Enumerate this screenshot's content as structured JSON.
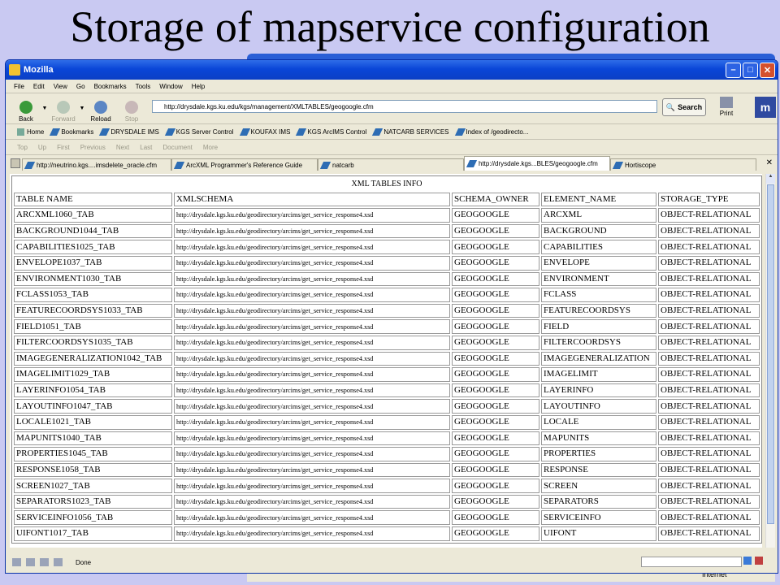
{
  "slide": {
    "title": "Storage of mapservice configuration"
  },
  "back_window": {
    "status_zone": "Internet"
  },
  "window": {
    "title": "Mozilla"
  },
  "menubar": [
    "File",
    "Edit",
    "View",
    "Go",
    "Bookmarks",
    "Tools",
    "Window",
    "Help"
  ],
  "nav": {
    "back": "Back",
    "forward": "Forward",
    "reload": "Reload",
    "stop": "Stop",
    "url": "http://drysdale.kgs.ku.edu/kgs/management/XMLTABLES/geogoogle.cfm",
    "search": "Search",
    "print": "Print",
    "brand": "m"
  },
  "bookmarks": [
    "Home",
    "Bookmarks",
    "DRYSDALE IMS",
    "KGS Server Control",
    "KOUFAX IMS",
    "KGS ArcIMS Control",
    "NATCARB SERVICES",
    "Index of /geodirecto..."
  ],
  "sitenav": [
    "Top",
    "Up",
    "First",
    "Previous",
    "Next",
    "Last",
    "Document",
    "More"
  ],
  "tabs": [
    "http://neutrino.kgs....imsdelete_oracle.cfm",
    "ArcXML Programmer's Reference Guide",
    "natcarb",
    "http://drysdale.kgs...BLES/geogoogle.cfm",
    "Hortiscope"
  ],
  "table": {
    "caption": "XML TABLES INFO",
    "headers": [
      "TABLE NAME",
      "XMLSCHEMA",
      "SCHEMA_OWNER",
      "ELEMENT_NAME",
      "STORAGE_TYPE"
    ],
    "rows": [
      [
        "ARCXML1060_TAB",
        "http://drysdale.kgs.ku.edu/geodirectory/arcims/get_service_response4.xsd",
        "GEOGOOGLE",
        "ARCXML",
        "OBJECT-RELATIONAL"
      ],
      [
        "BACKGROUND1044_TAB",
        "http://drysdale.kgs.ku.edu/geodirectory/arcims/get_service_response4.xsd",
        "GEOGOOGLE",
        "BACKGROUND",
        "OBJECT-RELATIONAL"
      ],
      [
        "CAPABILITIES1025_TAB",
        "http://drysdale.kgs.ku.edu/geodirectory/arcims/get_service_response4.xsd",
        "GEOGOOGLE",
        "CAPABILITIES",
        "OBJECT-RELATIONAL"
      ],
      [
        "ENVELOPE1037_TAB",
        "http://drysdale.kgs.ku.edu/geodirectory/arcims/get_service_response4.xsd",
        "GEOGOOGLE",
        "ENVELOPE",
        "OBJECT-RELATIONAL"
      ],
      [
        "ENVIRONMENT1030_TAB",
        "http://drysdale.kgs.ku.edu/geodirectory/arcims/get_service_response4.xsd",
        "GEOGOOGLE",
        "ENVIRONMENT",
        "OBJECT-RELATIONAL"
      ],
      [
        "FCLASS1053_TAB",
        "http://drysdale.kgs.ku.edu/geodirectory/arcims/get_service_response4.xsd",
        "GEOGOOGLE",
        "FCLASS",
        "OBJECT-RELATIONAL"
      ],
      [
        "FEATURECOORDSYS1033_TAB",
        "http://drysdale.kgs.ku.edu/geodirectory/arcims/get_service_response4.xsd",
        "GEOGOOGLE",
        "FEATURECOORDSYS",
        "OBJECT-RELATIONAL"
      ],
      [
        "FIELD1051_TAB",
        "http://drysdale.kgs.ku.edu/geodirectory/arcims/get_service_response4.xsd",
        "GEOGOOGLE",
        "FIELD",
        "OBJECT-RELATIONAL"
      ],
      [
        "FILTERCOORDSYS1035_TAB",
        "http://drysdale.kgs.ku.edu/geodirectory/arcims/get_service_response4.xsd",
        "GEOGOOGLE",
        "FILTERCOORDSYS",
        "OBJECT-RELATIONAL"
      ],
      [
        "IMAGEGENERALIZATION1042_TAB",
        "http://drysdale.kgs.ku.edu/geodirectory/arcims/get_service_response4.xsd",
        "GEOGOOGLE",
        "IMAGEGENERALIZATION",
        "OBJECT-RELATIONAL"
      ],
      [
        "IMAGELIMIT1029_TAB",
        "http://drysdale.kgs.ku.edu/geodirectory/arcims/get_service_response4.xsd",
        "GEOGOOGLE",
        "IMAGELIMIT",
        "OBJECT-RELATIONAL"
      ],
      [
        "LAYERINFO1054_TAB",
        "http://drysdale.kgs.ku.edu/geodirectory/arcims/get_service_response4.xsd",
        "GEOGOOGLE",
        "LAYERINFO",
        "OBJECT-RELATIONAL"
      ],
      [
        "LAYOUTINFO1047_TAB",
        "http://drysdale.kgs.ku.edu/geodirectory/arcims/get_service_response4.xsd",
        "GEOGOOGLE",
        "LAYOUTINFO",
        "OBJECT-RELATIONAL"
      ],
      [
        "LOCALE1021_TAB",
        "http://drysdale.kgs.ku.edu/geodirectory/arcims/get_service_response4.xsd",
        "GEOGOOGLE",
        "LOCALE",
        "OBJECT-RELATIONAL"
      ],
      [
        "MAPUNITS1040_TAB",
        "http://drysdale.kgs.ku.edu/geodirectory/arcims/get_service_response4.xsd",
        "GEOGOOGLE",
        "MAPUNITS",
        "OBJECT-RELATIONAL"
      ],
      [
        "PROPERTIES1045_TAB",
        "http://drysdale.kgs.ku.edu/geodirectory/arcims/get_service_response4.xsd",
        "GEOGOOGLE",
        "PROPERTIES",
        "OBJECT-RELATIONAL"
      ],
      [
        "RESPONSE1058_TAB",
        "http://drysdale.kgs.ku.edu/geodirectory/arcims/get_service_response4.xsd",
        "GEOGOOGLE",
        "RESPONSE",
        "OBJECT-RELATIONAL"
      ],
      [
        "SCREEN1027_TAB",
        "http://drysdale.kgs.ku.edu/geodirectory/arcims/get_service_response4.xsd",
        "GEOGOOGLE",
        "SCREEN",
        "OBJECT-RELATIONAL"
      ],
      [
        "SEPARATORS1023_TAB",
        "http://drysdale.kgs.ku.edu/geodirectory/arcims/get_service_response4.xsd",
        "GEOGOOGLE",
        "SEPARATORS",
        "OBJECT-RELATIONAL"
      ],
      [
        "SERVICEINFO1056_TAB",
        "http://drysdale.kgs.ku.edu/geodirectory/arcims/get_service_response4.xsd",
        "GEOGOOGLE",
        "SERVICEINFO",
        "OBJECT-RELATIONAL"
      ],
      [
        "UIFONT1017_TAB",
        "http://drysdale.kgs.ku.edu/geodirectory/arcims/get_service_response4.xsd",
        "GEOGOOGLE",
        "UIFONT",
        "OBJECT-RELATIONAL"
      ]
    ]
  },
  "status": {
    "text": "Done"
  },
  "icons": {
    "back": "back-arrow-icon",
    "forward": "forward-arrow-icon",
    "reload": "reload-icon",
    "stop": "stop-icon",
    "print": "printer-icon",
    "bookmark": "bookmark-icon"
  },
  "colors": {
    "titlebar": "#0a46d8",
    "slide_bg": "#c9c9f2",
    "chrome": "#ece9d8"
  }
}
